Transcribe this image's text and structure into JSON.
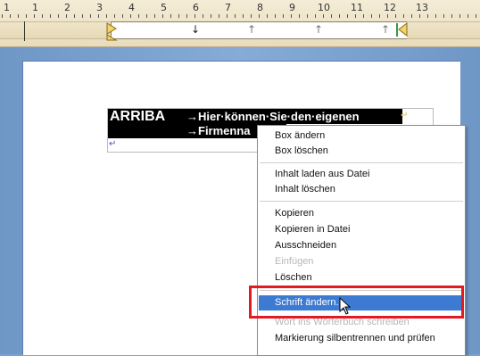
{
  "ruler": {
    "numbers": [
      "1",
      "1",
      "2",
      "3",
      "4",
      "5",
      "6",
      "7",
      "8",
      "9",
      "10",
      "11",
      "12",
      "13"
    ]
  },
  "document": {
    "arriba": "ARRIBA",
    "line1": "→Hier·können·Sie·den·eigenen",
    "line2": "→Firmenna"
  },
  "context_menu": {
    "items": [
      {
        "label": "Box ändern",
        "enabled": true
      },
      {
        "label": "Box löschen",
        "enabled": true
      },
      {
        "label": "Inhalt laden aus Datei",
        "enabled": true
      },
      {
        "label": "Inhalt löschen",
        "enabled": true
      },
      {
        "label": "Kopieren",
        "enabled": true
      },
      {
        "label": "Kopieren in Datei",
        "enabled": true
      },
      {
        "label": "Ausschneiden",
        "enabled": true
      },
      {
        "label": "Einfügen",
        "enabled": false
      },
      {
        "label": "Löschen",
        "enabled": true
      },
      {
        "label": "Schrift ändern...",
        "enabled": true,
        "hover": true
      },
      {
        "label": "Wort ins Wörterbuch schreiben",
        "enabled": false
      },
      {
        "label": "Markierung silbentrennen und prüfen",
        "enabled": true
      }
    ]
  },
  "colors": {
    "hover": "#3d7bd2",
    "highlight_box": "#e21b23",
    "workspace": "#7aa2cf"
  }
}
